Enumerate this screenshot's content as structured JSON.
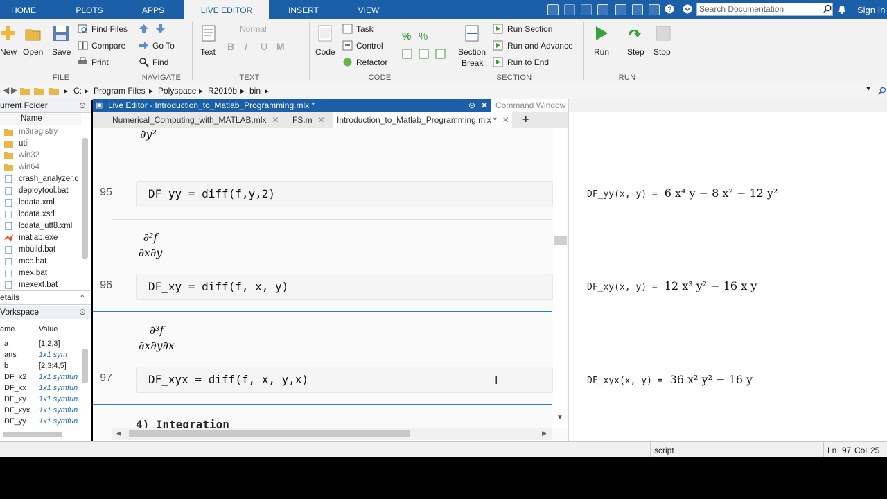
{
  "top_tabs": [
    "HOME",
    "PLOTS",
    "APPS",
    "LIVE EDITOR",
    "INSERT",
    "VIEW"
  ],
  "search": {
    "placeholder": "Search Documentation"
  },
  "signin": "Sign In",
  "ribbon": {
    "file": {
      "new": "New",
      "open": "Open",
      "save": "Save",
      "find_files": "Find Files",
      "compare": "Compare",
      "print": "Print",
      "title": "FILE"
    },
    "navigate": {
      "go_to": "Go To",
      "find": "Find",
      "title": "NAVIGATE"
    },
    "text": {
      "text": "Text",
      "style": "Normal",
      "bold": "B",
      "italic": "I",
      "underline": "U",
      "mono": "M",
      "title": "TEXT"
    },
    "code": {
      "code": "Code",
      "task": "Task",
      "control": "Control",
      "refactor": "Refactor",
      "title": "CODE"
    },
    "section": {
      "section_break_1": "Section",
      "section_break_2": "Break",
      "run_section": "Run Section",
      "run_and_advance": "Run and Advance",
      "run_to_end": "Run to End",
      "title": "SECTION"
    },
    "run": {
      "run": "Run",
      "step": "Step",
      "stop": "Stop",
      "title": "RUN"
    }
  },
  "address": {
    "parts": [
      "C:",
      "Program Files",
      "Polyspace",
      "R2019b",
      "bin"
    ]
  },
  "current_folder": {
    "title": "urrent Folder",
    "column": "Name",
    "files": [
      "m3iregistry",
      "util",
      "win32",
      "win64",
      "crash_analyzer.c",
      "deploytool.bat",
      "lcdata.xml",
      "lcdata.xsd",
      "lcdata_utf8.xml",
      "matlab.exe",
      "mbuild.bat",
      "mcc.bat",
      "mex.bat",
      "mexext.bat"
    ]
  },
  "details": {
    "title": "etails"
  },
  "workspace": {
    "title": "Vorkspace",
    "col_name": "ame",
    "col_value": "Value",
    "rows": [
      {
        "name": "a",
        "value": "[1,2,3]"
      },
      {
        "name": "ans",
        "value": "1x1 sym"
      },
      {
        "name": "b",
        "value": "[2,3;4,5]"
      },
      {
        "name": "DF_x2",
        "value": "1x1 symfun"
      },
      {
        "name": "DF_xx",
        "value": "1x1 symfun"
      },
      {
        "name": "DF_xy",
        "value": "1x1 symfun"
      },
      {
        "name": "DF_xyx",
        "value": "1x1 symfun"
      },
      {
        "name": "DF_yy",
        "value": "1x1 symfun"
      }
    ]
  },
  "editor": {
    "title": "Live Editor - Introduction_to_Matlab_Programming.mlx *",
    "tabs": [
      "Numerical_Computing_with_MATLAB.mlx",
      "FS.m",
      "Introduction_to_Matlab_Programming.mlx *"
    ],
    "lines": [
      {
        "num": "95",
        "code": "DF_yy = diff(f,y,2)",
        "frac_num": "",
        "frac_den": "∂y²"
      },
      {
        "num": "96",
        "code": "DF_xy = diff(f, x, y)",
        "frac_num": "∂²f",
        "frac_den": "∂x∂y"
      },
      {
        "num": "97",
        "code": "DF_xyx = diff(f, x, y,x)",
        "frac_num": "∂³f",
        "frac_den": "∂x∂y∂x"
      }
    ],
    "next_heading": "4) Integration"
  },
  "output": {
    "title": "Command Window",
    "results": [
      {
        "var": "DF_yy(x, y)  =",
        "expr": "6 x⁴ y − 8 x² − 12 y²"
      },
      {
        "var": "DF_xy(x, y)  =",
        "expr": "12 x³ y² − 16 x y"
      },
      {
        "var": "DF_xyx(x, y)  =",
        "expr": "36 x² y² − 16 y"
      }
    ]
  },
  "status": {
    "mode": "script",
    "ln_label": "Ln",
    "ln": "97",
    "col_label": "Col",
    "col": "25"
  },
  "colors": {
    "accent": "#1a5fa8",
    "output_line": "#2a7fd0"
  }
}
